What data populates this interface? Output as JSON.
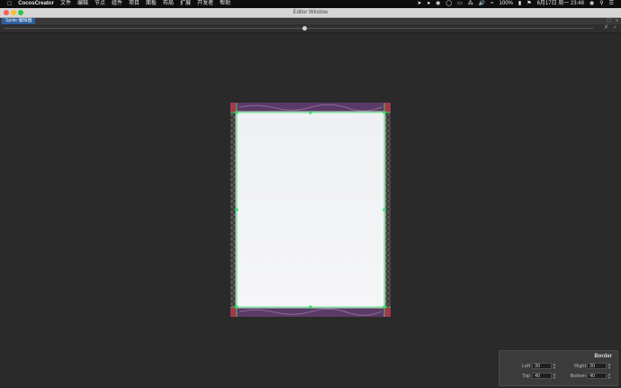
{
  "menubar": {
    "app_name": "CocosCreator",
    "items": [
      "文件",
      "编辑",
      "节点",
      "组件",
      "项目",
      "面板",
      "布局",
      "扩展",
      "开发者",
      "帮助"
    ],
    "battery": "100%",
    "datetime": "6月17日 周一  23:48"
  },
  "window": {
    "title": "Editor Window",
    "traffic_colors": [
      "#fc5f57",
      "#fdbc2e",
      "#28c840"
    ]
  },
  "tab": {
    "label": "Sprite 编辑器"
  },
  "toolbar": {
    "zoom_fraction": 0.51
  },
  "border_panel": {
    "title": "Border",
    "left_label": "Left",
    "left_value": "30",
    "right_label": "Right",
    "right_value": "30",
    "top_label": "Top",
    "top_value": "40",
    "bottom_label": "Bottom",
    "bottom_value": "40"
  },
  "colors": {
    "accent": "#2f5f9d",
    "guide": "#3ce06a",
    "frame": "#5a3a66"
  }
}
